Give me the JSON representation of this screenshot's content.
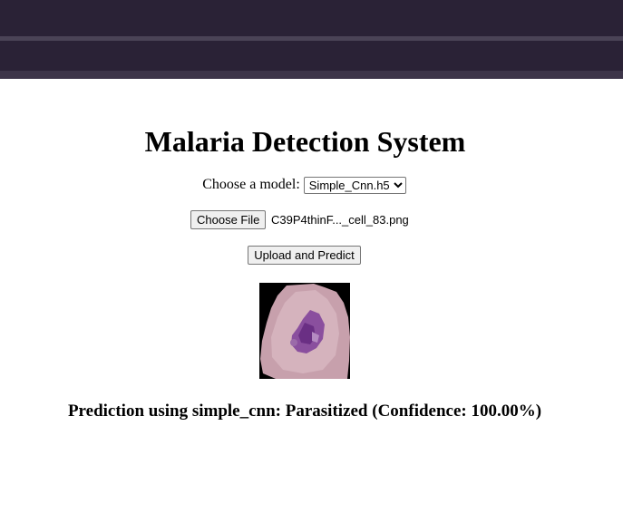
{
  "page": {
    "title": "Malaria Detection System"
  },
  "model": {
    "label": "Choose a model:",
    "selected": "Simple_Cnn.h5"
  },
  "file": {
    "choose_label": "Choose File",
    "file_name": "C39P4thinF..._cell_83.png"
  },
  "upload": {
    "button_label": "Upload and Predict"
  },
  "result": {
    "text": "Prediction using simple_cnn: Parasitized (Confidence: 100.00%)"
  }
}
